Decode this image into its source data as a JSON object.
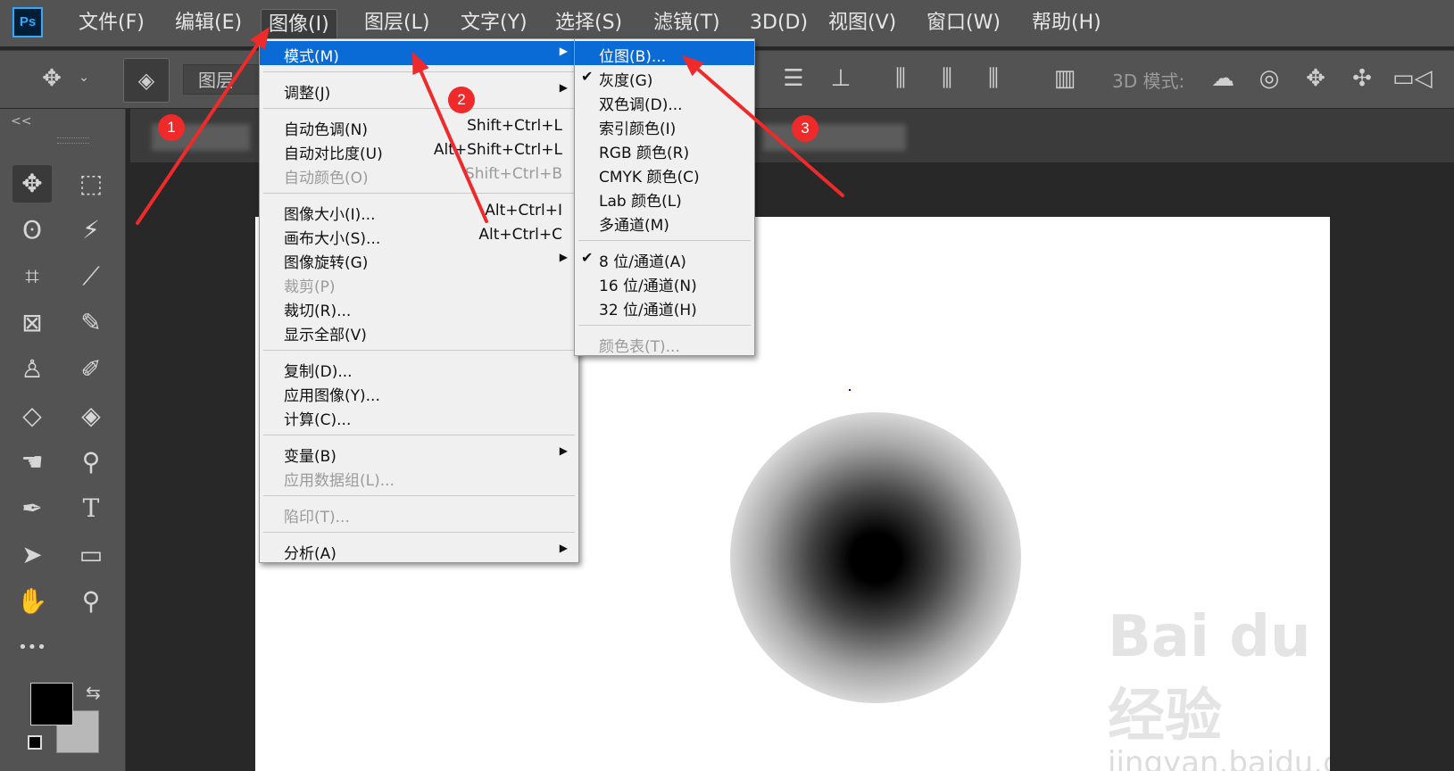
{
  "app": {
    "logo": "Ps"
  },
  "menubar": {
    "items": [
      "文件(F)",
      "编辑(E)",
      "图像(I)",
      "图层(L)",
      "文字(Y)",
      "选择(S)",
      "滤镜(T)",
      "3D(D)",
      "视图(V)",
      "窗口(W)",
      "帮助(H)"
    ],
    "active_index": 2
  },
  "optionsbar": {
    "layer_select": "图层",
    "label_3d": "3D 模式:",
    "icons": [
      "move-icon",
      "chevron-down-icon",
      "auto-select-layers-icon",
      "align-vertical-center-icon",
      "align-bottom-icon",
      "distribute-left-icon",
      "distribute-horizontal-center-icon",
      "distribute-right-icon",
      "align-panel-icon",
      "orbit-3d-icon",
      "roll-3d-icon",
      "pan-3d-icon",
      "slide-3d-icon",
      "camera-3d-icon"
    ]
  },
  "toolbox": {
    "collapse_label": "<<",
    "tools": [
      "move-tool",
      "marquee-tool",
      "lasso-tool",
      "magic-wand-tool",
      "crop-tool",
      "eyedropper-tool",
      "frame-tool",
      "brush-tool",
      "stamp-tool",
      "history-brush-tool",
      "eraser-tool",
      "paint-bucket-tool",
      "smudge-tool",
      "dodge-tool",
      "pen-tool",
      "type-tool",
      "path-selection-tool",
      "rectangle-tool",
      "hand-tool",
      "zoom-tool",
      "more-tools"
    ],
    "type_tool_glyph": "T",
    "more_glyph": "•••",
    "foreground_color": "#000000",
    "background_color": "#b8b8b8"
  },
  "image_menu": {
    "items": [
      {
        "label": "模式(M)",
        "submenu": true,
        "highlighted": true
      },
      {
        "separator": true
      },
      {
        "label": "调整(J)",
        "submenu": true
      },
      {
        "separator": true
      },
      {
        "label": "自动色调(N)",
        "shortcut": "Shift+Ctrl+L"
      },
      {
        "label": "自动对比度(U)",
        "shortcut": "Alt+Shift+Ctrl+L"
      },
      {
        "label": "自动颜色(O)",
        "shortcut": "Shift+Ctrl+B",
        "disabled": true
      },
      {
        "separator": true
      },
      {
        "label": "图像大小(I)...",
        "shortcut": "Alt+Ctrl+I"
      },
      {
        "label": "画布大小(S)...",
        "shortcut": "Alt+Ctrl+C"
      },
      {
        "label": "图像旋转(G)",
        "submenu": true
      },
      {
        "label": "裁剪(P)",
        "disabled": true
      },
      {
        "label": "裁切(R)..."
      },
      {
        "label": "显示全部(V)"
      },
      {
        "separator": true
      },
      {
        "label": "复制(D)..."
      },
      {
        "label": "应用图像(Y)..."
      },
      {
        "label": "计算(C)..."
      },
      {
        "separator": true
      },
      {
        "label": "变量(B)",
        "submenu": true
      },
      {
        "label": "应用数据组(L)...",
        "disabled": true
      },
      {
        "separator": true
      },
      {
        "label": "陷印(T)...",
        "disabled": true
      },
      {
        "separator": true
      },
      {
        "label": "分析(A)",
        "submenu": true
      }
    ]
  },
  "mode_menu": {
    "items": [
      {
        "label": "位图(B)...",
        "highlighted": true
      },
      {
        "label": "灰度(G)",
        "checked": true
      },
      {
        "label": "双色调(D)..."
      },
      {
        "label": "索引颜色(I)"
      },
      {
        "label": "RGB 颜色(R)"
      },
      {
        "label": "CMYK 颜色(C)"
      },
      {
        "label": "Lab 颜色(L)"
      },
      {
        "label": "多通道(M)"
      },
      {
        "separator": true
      },
      {
        "label": "8 位/通道(A)",
        "checked": true
      },
      {
        "label": "16 位/通道(N)"
      },
      {
        "label": "32 位/通道(H)"
      },
      {
        "separator": true
      },
      {
        "label": "颜色表(T)...",
        "disabled": true
      }
    ]
  },
  "annotations": {
    "badges": [
      "1",
      "2",
      "3"
    ],
    "color": "#ee2a2a"
  },
  "watermark": {
    "main": "Bai du 经验",
    "sub": "jingyan.baidu.com"
  }
}
